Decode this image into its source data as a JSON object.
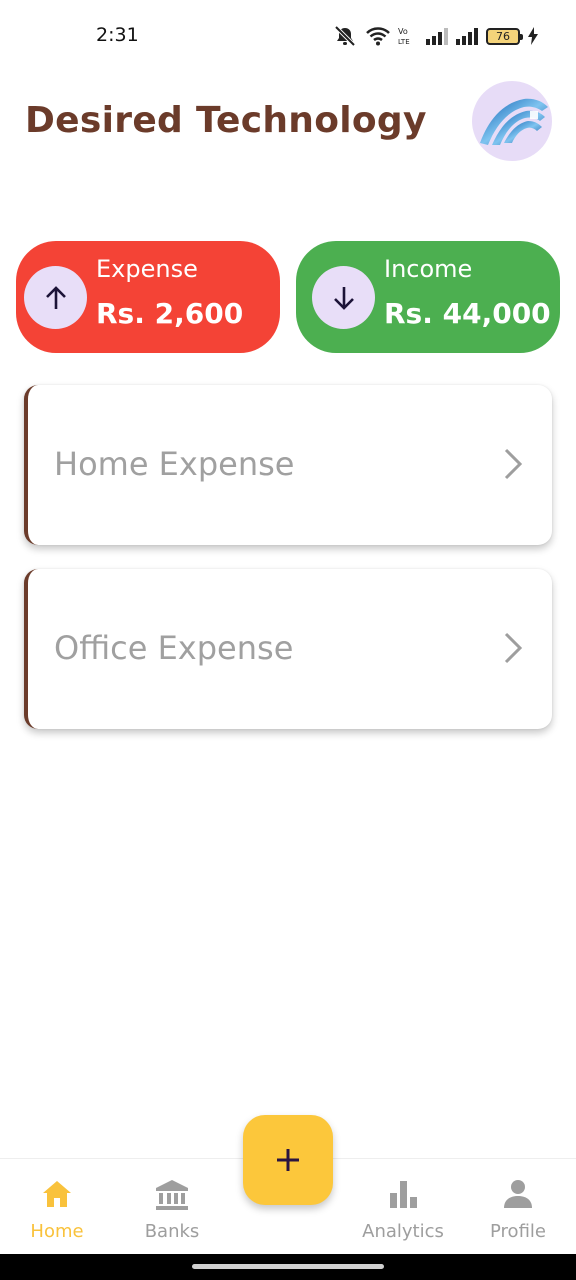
{
  "status_bar": {
    "time": "2:31",
    "battery": "76"
  },
  "header": {
    "title": "Desired Technology"
  },
  "summary": {
    "expense": {
      "label": "Expense",
      "amount": "Rs. 2,600",
      "color": "#f44336"
    },
    "income": {
      "label": "Income",
      "amount": "Rs. 44,000",
      "color": "#4caf50"
    }
  },
  "categories": [
    {
      "label": "Home Expense"
    },
    {
      "label": "Office Expense"
    }
  ],
  "bottom_nav": {
    "items": [
      {
        "label": "Home",
        "icon": "home-icon",
        "active": true
      },
      {
        "label": "Banks",
        "icon": "bank-icon",
        "active": false
      },
      {
        "label": "Analytics",
        "icon": "bar-chart-icon",
        "active": false
      },
      {
        "label": "Profile",
        "icon": "person-icon",
        "active": false
      }
    ],
    "active_color": "#f9c23c",
    "fab_color": "#fcc73b"
  }
}
